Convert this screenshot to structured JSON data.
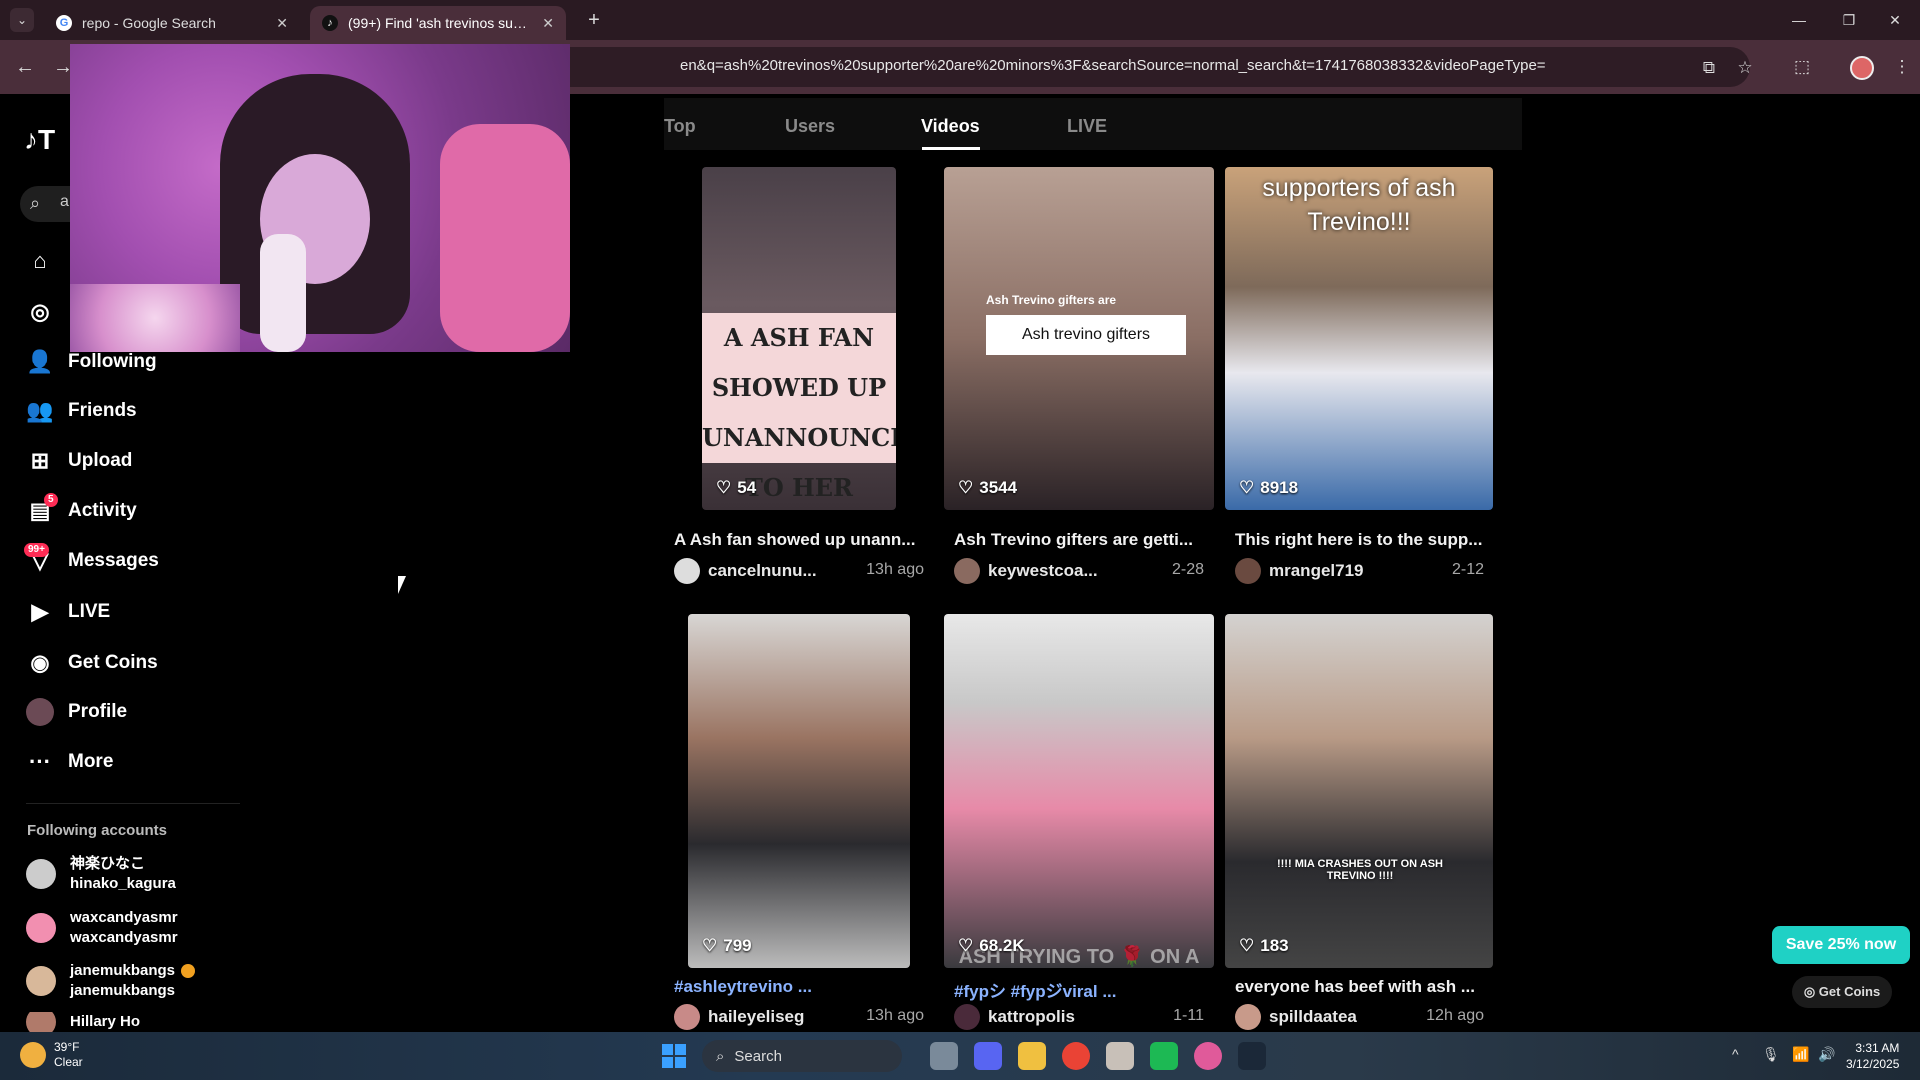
{
  "browser": {
    "tabs": [
      {
        "title": "repo - Google Search",
        "favicon": "google-icon",
        "active": false
      },
      {
        "title": "(99+) Find 'ash trevinos suppor",
        "favicon": "tiktok-icon",
        "active": true
      }
    ],
    "url": "en&q=ash%20trevinos%20supporter%20are%20minors%3F&searchSource=normal_search&t=1741768038332&videoPageType="
  },
  "sidebar": {
    "logo": "♪T",
    "search_initial": "a",
    "items": [
      {
        "label": "",
        "icon": "home-icon"
      },
      {
        "label": "",
        "icon": "compass-icon"
      },
      {
        "label": "Following",
        "icon": "following-icon"
      },
      {
        "label": "Friends",
        "icon": "friends-icon"
      },
      {
        "label": "Upload",
        "icon": "upload-icon"
      },
      {
        "label": "Activity",
        "icon": "activity-icon",
        "badge": "5"
      },
      {
        "label": "Messages",
        "icon": "messages-icon",
        "badge": "99+"
      },
      {
        "label": "LIVE",
        "icon": "live-icon"
      },
      {
        "label": "Get Coins",
        "icon": "coins-icon"
      },
      {
        "label": "Profile",
        "icon": "profile-avatar"
      },
      {
        "label": "More",
        "icon": "more-icon"
      }
    ],
    "following_title": "Following accounts",
    "accounts": [
      {
        "name": "神楽ひなこ",
        "handle": "hinako_kagura"
      },
      {
        "name": "waxcandyasmr",
        "handle": "waxcandyasmr"
      },
      {
        "name": "janemukbangs",
        "handle": "janemukbangs",
        "verified": true
      },
      {
        "name": "Hillary Ho",
        "handle": ""
      }
    ]
  },
  "search_tabs": [
    "Top",
    "Users",
    "Videos",
    "LIVE"
  ],
  "active_tab": "Videos",
  "videos": [
    {
      "likes": "54",
      "title": "A Ash fan showed up unann...",
      "author": "cancelnunu...",
      "date": "13h ago",
      "overlay": "A ASH FAN SHOWED UP UNANNOUNCED TO HER HOUSE 😱"
    },
    {
      "likes": "3544",
      "title": "Ash Trevino gifters are getti...",
      "author": "keywestcoa...",
      "date": "2-28",
      "overlay_small": "Ash Trevino gifters are",
      "overlay": "Ash trevino gifters"
    },
    {
      "likes": "8918",
      "title": "This right here is to the supp...",
      "author": "mrangel719",
      "date": "2-12",
      "overlay": "supporters of ash Trevino!!!"
    },
    {
      "likes": "799",
      "title": "#ashleytrevino ...",
      "author": "haileyeliseg",
      "date": "13h ago",
      "overlay": ""
    },
    {
      "likes": "68.2K",
      "title": "#fypシ #fypジviral ...",
      "author": "kattropolis",
      "date": "1-11",
      "overlay": "ASH TRYING TO 🌹 ON A"
    },
    {
      "likes": "183",
      "title": "everyone has beef with ash ...",
      "author": "spilldaatea",
      "date": "12h ago",
      "overlay": "!!!! MIA CRASHES OUT ON ASH TREVINO !!!!"
    }
  ],
  "promo_button": "Save 25% now",
  "get_coins_float": "Get Coins",
  "taskbar": {
    "temp": "39°F",
    "condition": "Clear",
    "search": "Search",
    "time": "3:31 AM",
    "date": "3/12/2025"
  }
}
